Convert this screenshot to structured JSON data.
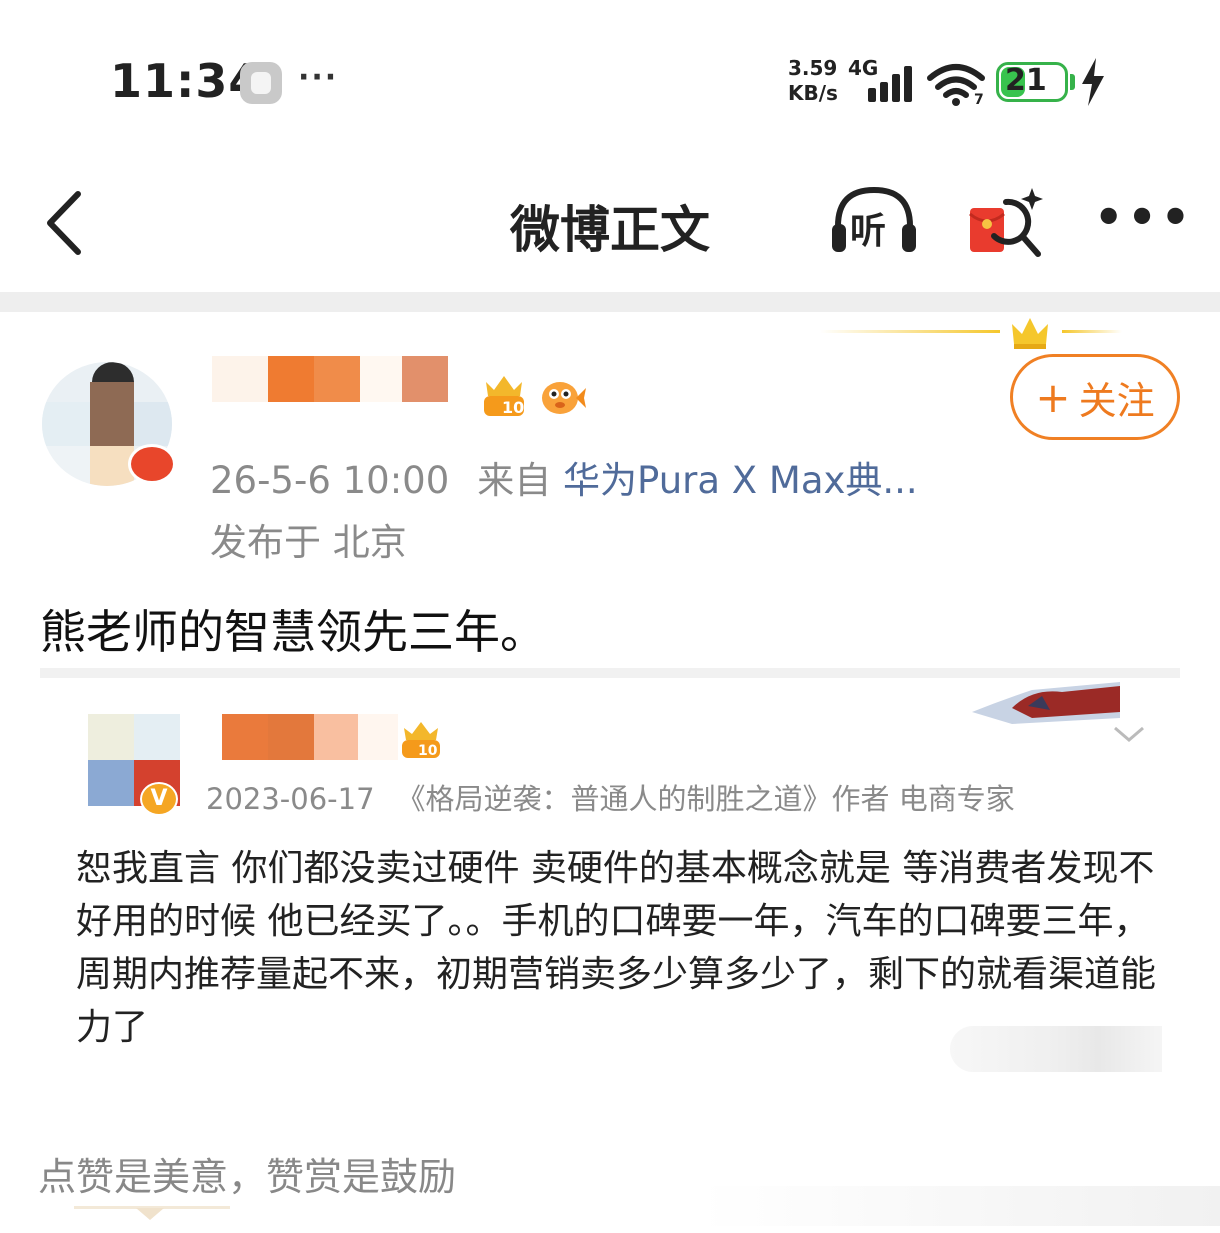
{
  "status_bar": {
    "time": "11:34",
    "dots": "···",
    "net_speed_value": "3.59",
    "net_speed_unit": "KB/s",
    "net_type": "4G",
    "wifi_sub": "7",
    "battery": "21",
    "colors": {
      "battery": "#38c34e"
    }
  },
  "nav": {
    "title": "微博正文",
    "listen_label": "听",
    "more_label": "•••"
  },
  "post": {
    "date": "26-5-6 10:00",
    "from_label": "来自",
    "source": "华为Pura X Max典...",
    "location": "发布于 北京",
    "text": "熊老师的智慧领先三年。",
    "follow_label": "关注",
    "follow_plus": "+"
  },
  "quote": {
    "date": "2023-06-17",
    "author_desc": "《格局逆袭：普通人的制胜之道》作者 电商专家",
    "body": "恕我直言 你们都没卖过硬件 卖硬件的基本概念就是 等消费者发现不好用的时候 他已经买了。。手机的口碑要一年，汽车的口碑要三年，周期内推荐量起不来，初期营销卖多少算多少了，剩下的就看渠道能力了",
    "v_badge": "V"
  },
  "reward": {
    "text": "点赞是美意，赞赏是鼓励"
  },
  "colors": {
    "accent": "#ee7a1f",
    "source_link": "#506b9a",
    "meta_gray": "#8a8a8a"
  }
}
